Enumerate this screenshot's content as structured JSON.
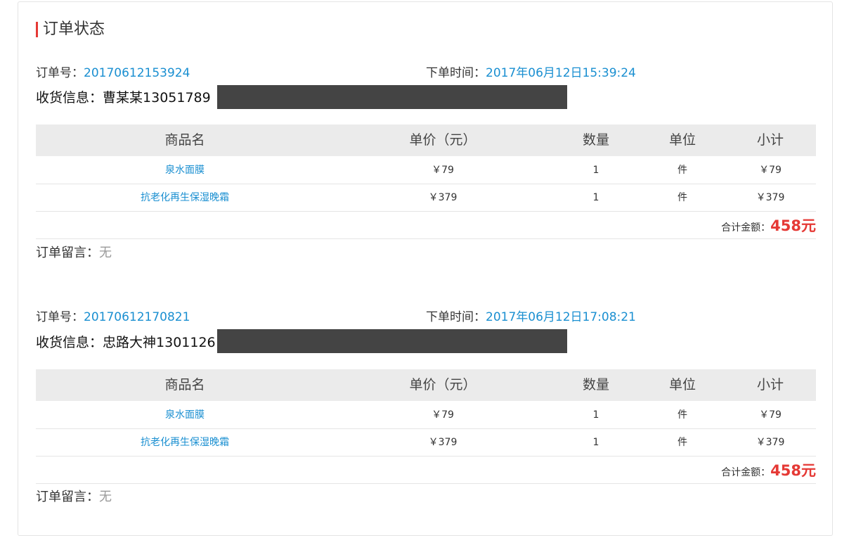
{
  "page_title": "订单状态",
  "labels": {
    "order_no": "订单号：",
    "order_time": "下单时间：",
    "shipping": "收货信息：",
    "remark": "订单留言：",
    "total": "合计金额："
  },
  "table_headers": [
    "商品名",
    "单价（元）",
    "数量",
    "单位",
    "小计"
  ],
  "orders": [
    {
      "order_no": "20170612153924",
      "order_time": "2017年06月12日15:39:24",
      "shipping": "曹某某13051789",
      "items": [
        {
          "name": "泉水面膜",
          "price": "￥79",
          "qty": "1",
          "unit": "件",
          "subtotal": "￥79"
        },
        {
          "name": "抗老化再生保湿晚霜",
          "price": "￥379",
          "qty": "1",
          "unit": "件",
          "subtotal": "￥379"
        }
      ],
      "total": "458元",
      "remark": "无"
    },
    {
      "order_no": "20170612170821",
      "order_time": "2017年06月12日17:08:21",
      "shipping": "忠路大神1301126",
      "items": [
        {
          "name": "泉水面膜",
          "price": "￥79",
          "qty": "1",
          "unit": "件",
          "subtotal": "￥79"
        },
        {
          "name": "抗老化再生保湿晚霜",
          "price": "￥379",
          "qty": "1",
          "unit": "件",
          "subtotal": "￥379"
        }
      ],
      "total": "458元",
      "remark": "无"
    }
  ],
  "colors": {
    "accent_red": "#e53935",
    "link_blue": "#1a8fd1",
    "header_gray": "#ebebeb",
    "redaction": "#444444"
  }
}
